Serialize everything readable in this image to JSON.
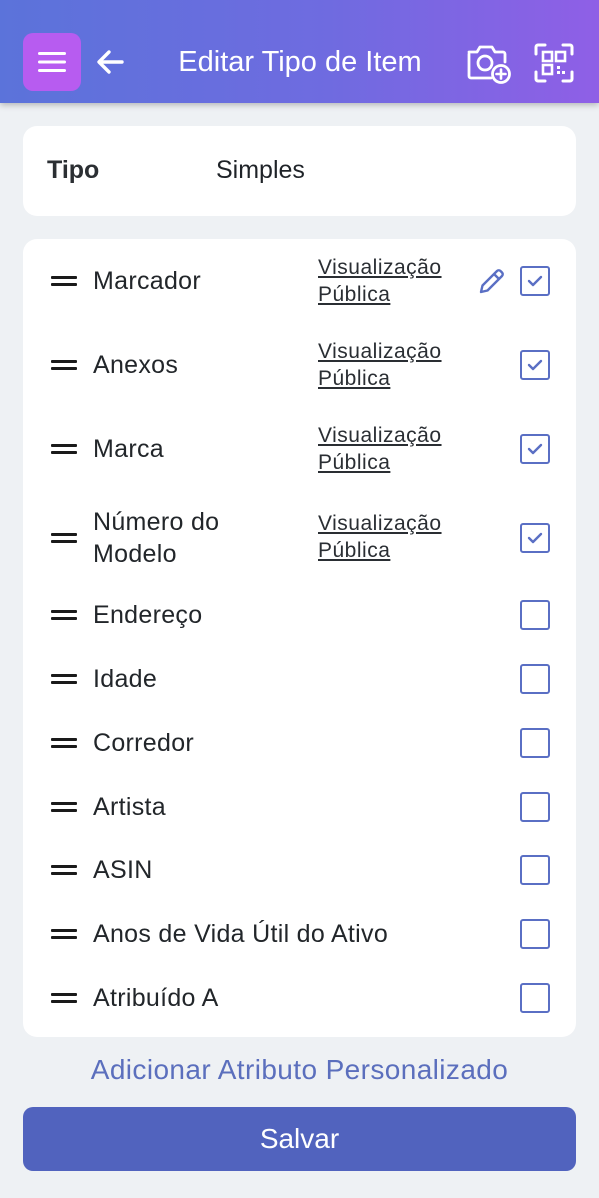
{
  "header": {
    "title": "Editar Tipo de Item",
    "menu_icon": "hamburger-menu-icon",
    "back_icon": "arrow-left-icon",
    "camera_icon": "camera-add-icon",
    "scan_icon": "qr-scan-icon",
    "gradient_start": "#5b73da",
    "gradient_end": "#8f5fe6",
    "menu_button_color": "#b75cf0"
  },
  "type": {
    "label": "Tipo",
    "value": "Simples"
  },
  "attributes": [
    {
      "label": "Marcador",
      "label_line2": "",
      "visibility_line1": "Visualização",
      "visibility_line2": "Pública",
      "editable": true,
      "checked": true
    },
    {
      "label": "Anexos",
      "label_line2": "",
      "visibility_line1": "Visualização",
      "visibility_line2": "Pública",
      "editable": false,
      "checked": true
    },
    {
      "label": "Marca",
      "label_line2": "",
      "visibility_line1": "Visualização",
      "visibility_line2": "Pública",
      "editable": false,
      "checked": true
    },
    {
      "label": "Número do",
      "label_line2": "Modelo",
      "visibility_line1": "Visualização",
      "visibility_line2": "Pública",
      "editable": false,
      "checked": true
    },
    {
      "label": "Endereço",
      "label_line2": "",
      "visibility_line1": "",
      "visibility_line2": "",
      "editable": false,
      "checked": false
    },
    {
      "label": "Idade",
      "label_line2": "",
      "visibility_line1": "",
      "visibility_line2": "",
      "editable": false,
      "checked": false
    },
    {
      "label": "Corredor",
      "label_line2": "",
      "visibility_line1": "",
      "visibility_line2": "",
      "editable": false,
      "checked": false
    },
    {
      "label": "Artista",
      "label_line2": "",
      "visibility_line1": "",
      "visibility_line2": "",
      "editable": false,
      "checked": false
    },
    {
      "label": "ASIN",
      "label_line2": "",
      "visibility_line1": "",
      "visibility_line2": "",
      "editable": false,
      "checked": false
    },
    {
      "label": "Anos de Vida Útil do Ativo",
      "label_line2": "",
      "visibility_line1": "",
      "visibility_line2": "",
      "editable": false,
      "checked": false
    },
    {
      "label": "Atribuído A",
      "label_line2": "",
      "visibility_line1": "",
      "visibility_line2": "",
      "editable": false,
      "checked": false
    }
  ],
  "add_custom_attribute": "Adicionar Atributo Personalizado",
  "save_button": "Salvar",
  "colors": {
    "accent": "#5163be",
    "checkbox": "#5a6fc4",
    "link": "#5b6fbd"
  }
}
